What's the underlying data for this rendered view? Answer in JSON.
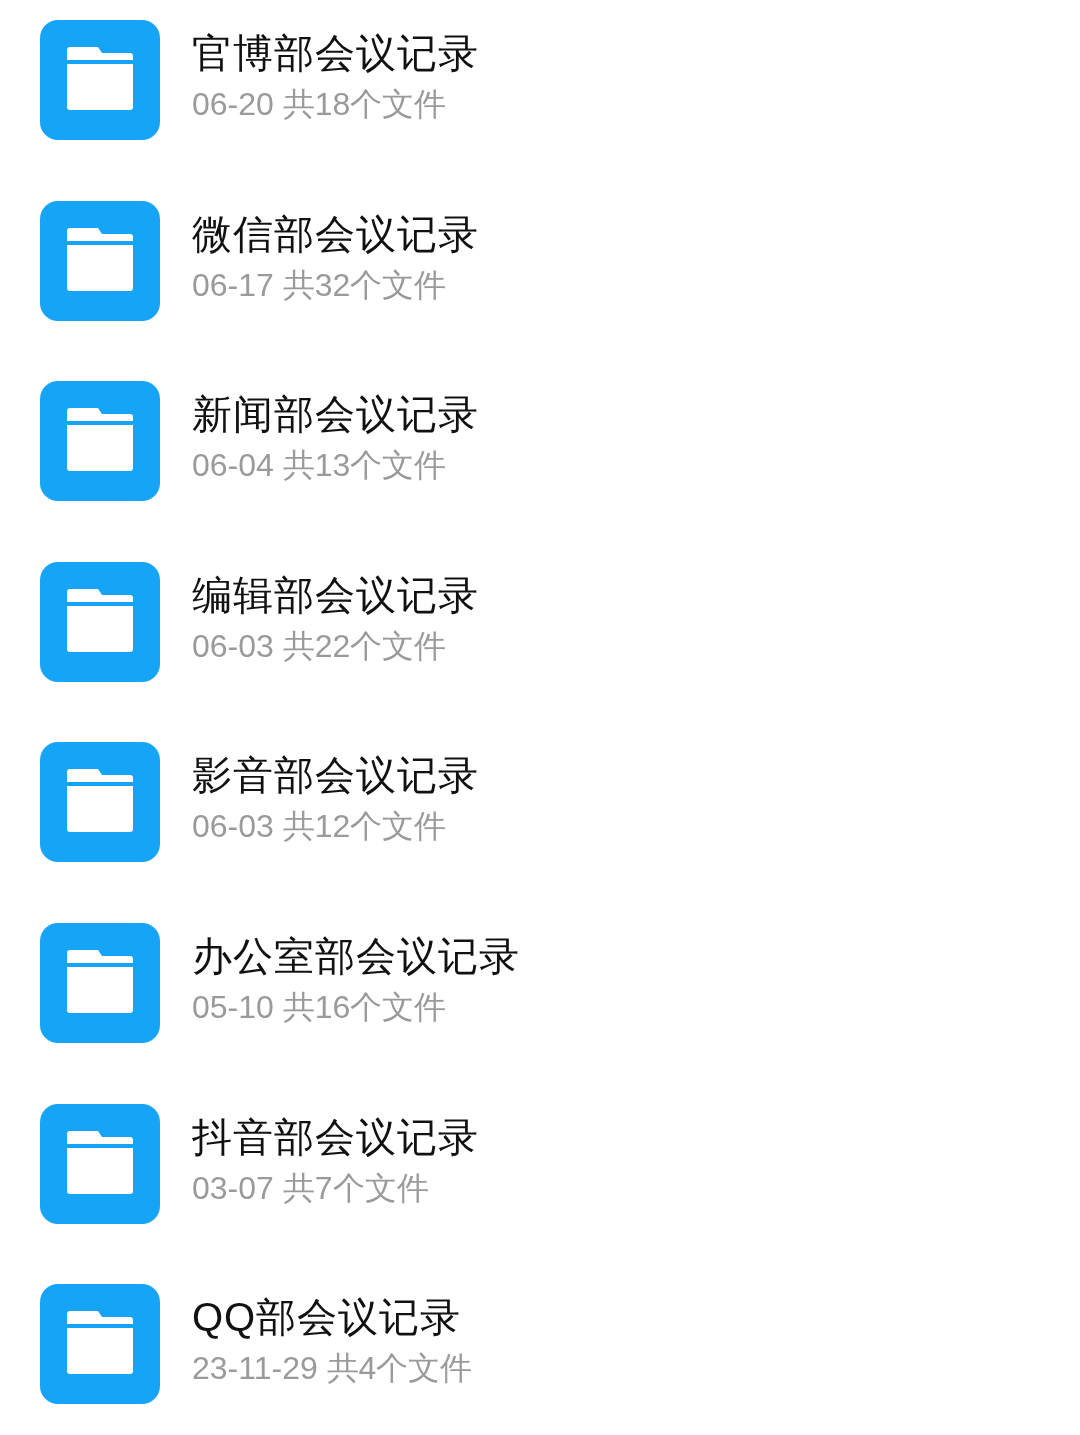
{
  "folders": [
    {
      "name": "官博部会议记录",
      "info": "06-20 共18个文件"
    },
    {
      "name": "微信部会议记录",
      "info": "06-17 共32个文件"
    },
    {
      "name": "新闻部会议记录",
      "info": "06-04 共13个文件"
    },
    {
      "name": "编辑部会议记录",
      "info": "06-03 共22个文件"
    },
    {
      "name": "影音部会议记录",
      "info": "06-03 共12个文件"
    },
    {
      "name": "办公室部会议记录",
      "info": "05-10 共16个文件"
    },
    {
      "name": "抖音部会议记录",
      "info": "03-07 共7个文件"
    },
    {
      "name": "QQ部会议记录",
      "info": "23-11-29 共4个文件"
    }
  ]
}
